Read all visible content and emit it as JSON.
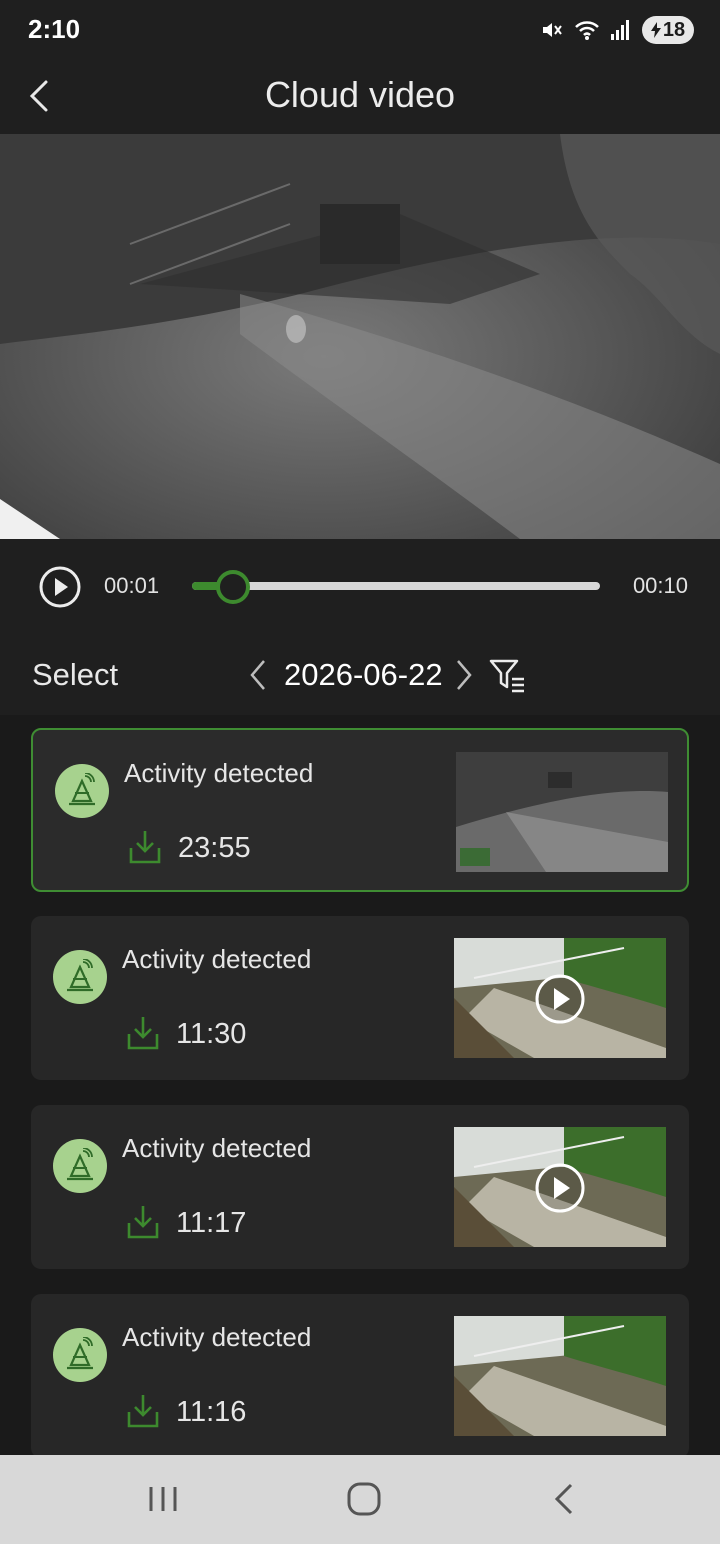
{
  "status_bar": {
    "time": "2:10",
    "battery": "18",
    "icons": [
      "mute-icon",
      "wifi-icon",
      "signal-icon",
      "battery-charging-icon"
    ]
  },
  "app_bar": {
    "title": "Cloud video",
    "back_icon": "chevron-left-icon"
  },
  "player": {
    "current_time": "00:01",
    "total_time": "00:10",
    "progress": 0.1,
    "play_icon": "play-circle-icon"
  },
  "filter_bar": {
    "select_label": "Select",
    "date": "2026-06-22",
    "prev_icon": "chevron-left-icon",
    "next_icon": "chevron-right-icon",
    "filter_icon": "filter-list-icon"
  },
  "events": [
    {
      "title": "Activity detected",
      "time": "23:55",
      "selected": true,
      "thumbnail": "night",
      "has_play": false
    },
    {
      "title": "Activity detected",
      "time": "11:30",
      "selected": false,
      "thumbnail": "day",
      "has_play": true
    },
    {
      "title": "Activity detected",
      "time": "11:17",
      "selected": false,
      "thumbnail": "day",
      "has_play": true
    },
    {
      "title": "Activity detected",
      "time": "11:16",
      "selected": false,
      "thumbnail": "day",
      "has_play": false
    }
  ],
  "colors": {
    "accent": "#3d8a2e",
    "avatar_bg": "#a7d28e",
    "background": "#1b1b1b",
    "card": "#272727"
  },
  "nav_bar": {
    "icons": [
      "recent-apps-icon",
      "home-icon",
      "back-icon"
    ]
  }
}
